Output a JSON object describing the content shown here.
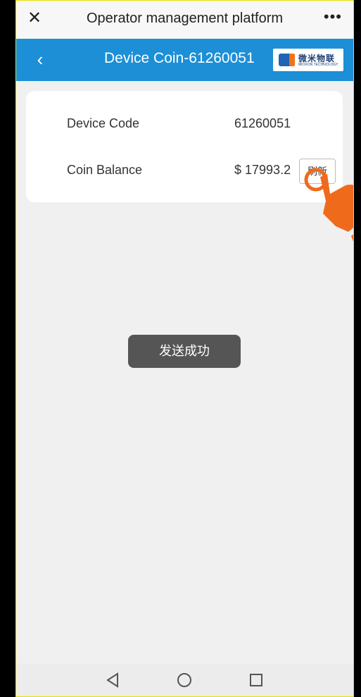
{
  "topbar": {
    "close_glyph": "✕",
    "title": "Operator management platform",
    "more_glyph": "•••"
  },
  "navbar": {
    "back_glyph": "‹",
    "title": "Device Coin-61260051",
    "logo_text": "微米物联",
    "logo_subtext": "MICRON TECHNOLOGY"
  },
  "card": {
    "device_code_label": "Device Code",
    "device_code_value": "61260051",
    "coin_balance_label": "Coin Balance",
    "coin_balance_value": "$ 17993.2",
    "refresh_button_label": "刷新"
  },
  "toast": {
    "message": "发送成功"
  },
  "system_nav": {
    "back_icon": "triangle-back-icon",
    "home_icon": "circle-home-icon",
    "recent_icon": "square-recent-icon"
  },
  "colors": {
    "navbar_blue": "#1c8fd6",
    "hand_orange": "#f06a1c",
    "toast_bg": "#555555"
  }
}
